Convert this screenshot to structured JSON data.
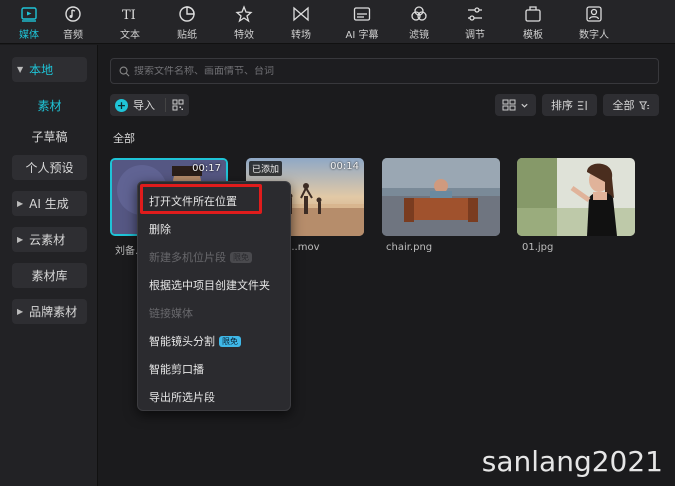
{
  "toolbar": {
    "tabs": [
      {
        "label": "媒体",
        "icon": "media-icon"
      },
      {
        "label": "音频",
        "icon": "audio-icon"
      },
      {
        "label": "文本",
        "icon": "text-icon"
      },
      {
        "label": "贴纸",
        "icon": "sticker-icon"
      },
      {
        "label": "特效",
        "icon": "effects-icon"
      },
      {
        "label": "转场",
        "icon": "transition-icon"
      },
      {
        "label": "AI 字幕",
        "icon": "ai-caption-icon"
      },
      {
        "label": "滤镜",
        "icon": "filter-icon"
      },
      {
        "label": "调节",
        "icon": "adjust-icon"
      },
      {
        "label": "模板",
        "icon": "template-icon"
      },
      {
        "label": "数字人",
        "icon": "digital-human-icon"
      }
    ],
    "active_index": 0
  },
  "sidebar": {
    "local": "本地",
    "material": "素材",
    "subdraft": "子草稿",
    "personal_preset": "个人预设",
    "ai_generate": "AI 生成",
    "cloud_material": "云素材",
    "library": "素材库",
    "brand_material": "品牌素材"
  },
  "search": {
    "placeholder": "搜索文件名称、画面情节、台词"
  },
  "actions": {
    "import": "导入",
    "sort": "排序",
    "all": "全部"
  },
  "section": {
    "title": "全部"
  },
  "media": [
    {
      "name": "刘备...",
      "duration": "00:17",
      "added": ""
    },
    {
      "name": "....mov",
      "duration": "00:14",
      "added": "已添加"
    },
    {
      "name": "chair.png",
      "duration": "",
      "added": ""
    },
    {
      "name": "01.jpg",
      "duration": "",
      "added": ""
    }
  ],
  "context_menu": {
    "items": [
      {
        "label": "打开文件所在位置",
        "enabled": true
      },
      {
        "label": "删除",
        "enabled": true
      },
      {
        "label": "新建多机位片段",
        "enabled": false,
        "badge": "限免"
      },
      {
        "label": "根据选中项目创建文件夹",
        "enabled": true
      },
      {
        "label": "链接媒体",
        "enabled": false
      },
      {
        "label": "智能镜头分割",
        "enabled": true,
        "badge": "限免"
      },
      {
        "label": "智能剪口播",
        "enabled": true
      },
      {
        "label": "导出所选片段",
        "enabled": true
      }
    ]
  },
  "watermark": "sanlang2021",
  "colors": {
    "accent": "#1fc4d7",
    "highlight": "#e01c1c"
  }
}
